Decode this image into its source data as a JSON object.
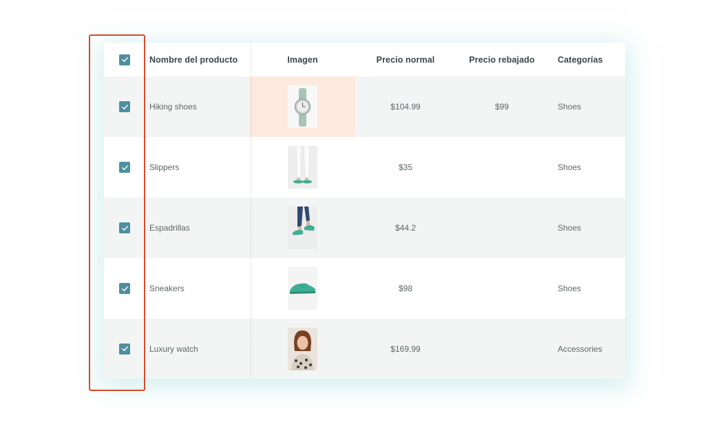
{
  "table": {
    "headers": {
      "name": "Nombre del producto",
      "image": "Imagen",
      "regular_price": "Precio normal",
      "sale_price": "Precio rebajado",
      "categories": "Categorías"
    },
    "select_all_checked": true,
    "rows": [
      {
        "checked": true,
        "name": "Hiking shoes",
        "image_icon": "watch-thumbnail",
        "regular_price": "$104.99",
        "sale_price": "$99",
        "category": "Shoes"
      },
      {
        "checked": true,
        "name": "Slippers",
        "image_icon": "slippers-thumbnail",
        "regular_price": "$35",
        "sale_price": "",
        "category": "Shoes"
      },
      {
        "checked": true,
        "name": "Espadrillas",
        "image_icon": "espadrilles-thumbnail",
        "regular_price": "$44.2",
        "sale_price": "",
        "category": "Shoes"
      },
      {
        "checked": true,
        "name": "Sneakers",
        "image_icon": "sneaker-thumbnail",
        "regular_price": "$98",
        "sale_price": "",
        "category": "Shoes"
      },
      {
        "checked": true,
        "name": "Luxury watch",
        "image_icon": "woman-portrait-thumbnail",
        "regular_price": "$169.99",
        "sale_price": "",
        "category": "Accessories"
      }
    ]
  },
  "colors": {
    "accent_checkbox": "#4e8fa0",
    "selection_frame": "#d44a2c",
    "row_alt_bg": "#f3f5f4",
    "image_highlight": "#fde9de"
  }
}
